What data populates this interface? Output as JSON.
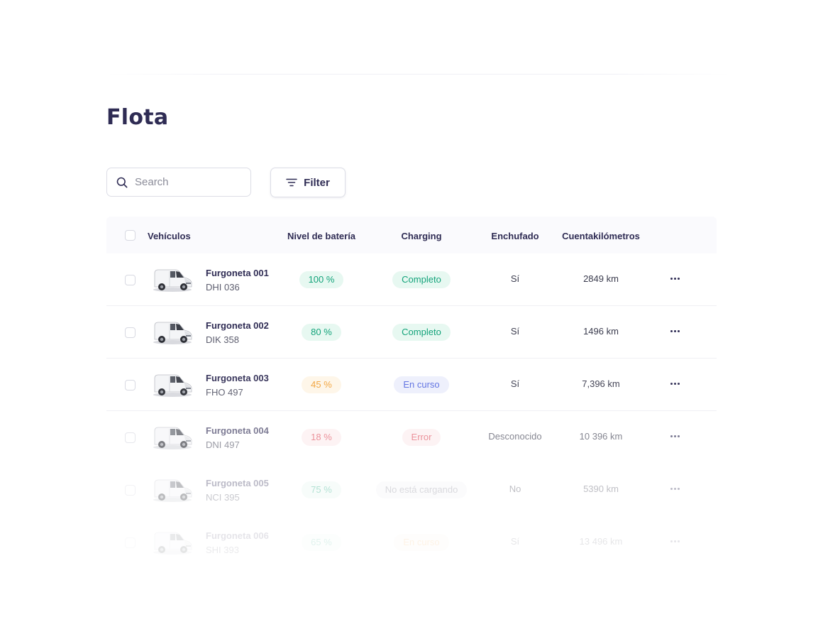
{
  "page": {
    "title": "Flota"
  },
  "toolbar": {
    "search_placeholder": "Search",
    "filter_label": "Filter"
  },
  "table": {
    "columns": {
      "vehicles": "Vehículos",
      "battery": "Nivel de batería",
      "charging": "Charging",
      "plugged": "Enchufado",
      "odometer": "Cuentakilómetros"
    },
    "rows": [
      {
        "name": "Furgoneta 001",
        "plate": "DHI 036",
        "battery": "100 %",
        "battery_status": "green",
        "charging": "Completo",
        "charging_status": "green",
        "plugged": "Sí",
        "odometer": "2849 km"
      },
      {
        "name": "Furgoneta 002",
        "plate": "DIK 358",
        "battery": "80 %",
        "battery_status": "green",
        "charging": "Completo",
        "charging_status": "green",
        "plugged": "Sí",
        "odometer": "1496 km"
      },
      {
        "name": "Furgoneta 003",
        "plate": "FHO 497",
        "battery": "45 %",
        "battery_status": "orange",
        "charging": "En curso",
        "charging_status": "blue",
        "plugged": "Sí",
        "odometer": "7,396 km"
      },
      {
        "name": "Furgoneta 004",
        "plate": "DNI 497",
        "battery": "18 %",
        "battery_status": "red",
        "charging": "Error",
        "charging_status": "red",
        "plugged": "Desconocido",
        "odometer": "10 396 km"
      },
      {
        "name": "Furgoneta 005",
        "plate": "NCI 395",
        "battery": "75 %",
        "battery_status": "green",
        "charging": "No está cargando",
        "charging_status": "gray",
        "plugged": "No",
        "odometer": "5390 km"
      },
      {
        "name": "Furgoneta 006",
        "plate": "SHI 393",
        "battery": "65 %",
        "battery_status": "green",
        "charging": "En curso",
        "charging_status": "orange",
        "plugged": "Sí",
        "odometer": "13 496 km"
      }
    ]
  },
  "colors": {
    "green_text": "#13a37a",
    "green_bg": "#e7f8f1",
    "orange_text": "#f2a33a",
    "orange_bg": "#fef6e8",
    "red_text": "#e0505e",
    "red_bg": "#fdecee",
    "blue_text": "#5b6ee1",
    "blue_bg": "#eef0fc",
    "gray_text": "#8d8e9c",
    "gray_bg": "#f3f3f7",
    "title": "#2f2c54"
  }
}
